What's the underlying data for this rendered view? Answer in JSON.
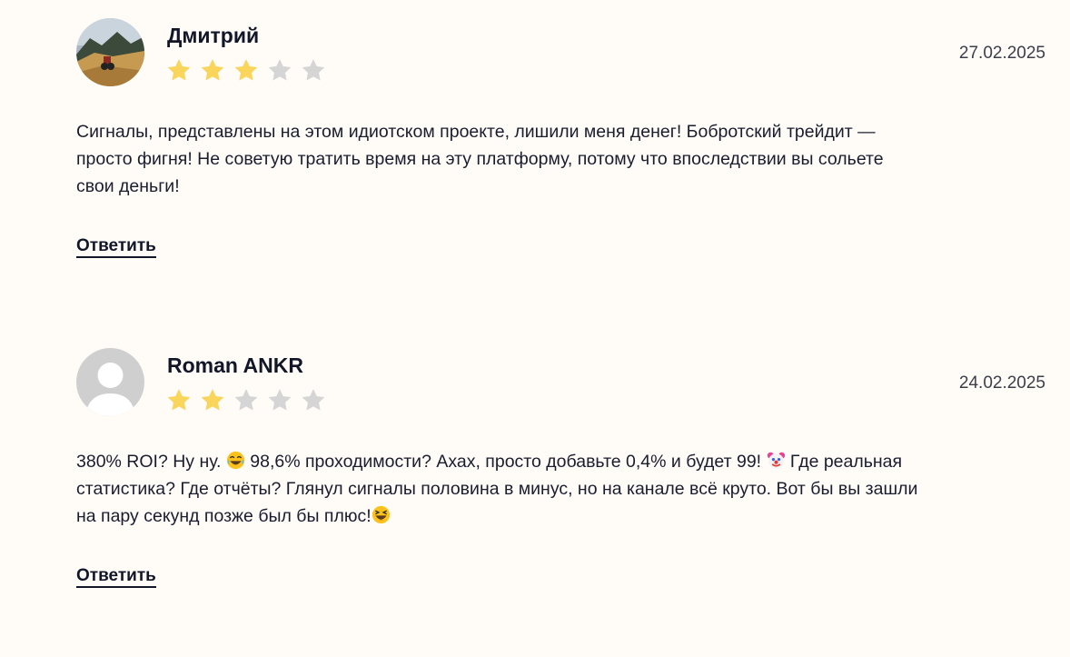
{
  "reviews": [
    {
      "author": "Дмитрий",
      "date": "27.02.2025",
      "rating": 3,
      "max_rating": 5,
      "avatar": "photo-avatar",
      "text_lines": [
        "Сигналы, представлены на этом идиотском проекте, лишили меня денег! Бобротский трейдит —",
        "просто фигня! Не советую тратить время на эту платформу, потому что впоследствии вы сольете",
        "свои деньги!"
      ],
      "reply_label": "Ответить"
    },
    {
      "author": "Roman ANKR",
      "date": "24.02.2025",
      "rating": 2,
      "max_rating": 5,
      "avatar": "default-user-avatar",
      "text_parts": {
        "p1": "380% ROI? Ну ну. ",
        "p2": " 98,6% проходимости? Ахах, просто добавьте 0,4% и будет 99! ",
        "p3": " Где реальная",
        "line2": "статистика? Где отчёты? Глянул сигналы половина в минус, но на канале всё круто. Вот бы вы зашли",
        "line3": "на пару секунд позже был бы плюс!"
      },
      "emojis": [
        "joy-emoji",
        "clown-emoji",
        "squinting-laugh-emoji"
      ],
      "reply_label": "Ответить"
    }
  ],
  "colors": {
    "background": "#fffcf8",
    "star_filled": "#f9d55c",
    "star_empty": "#d5d5d5",
    "text": "#1a1d2e"
  }
}
